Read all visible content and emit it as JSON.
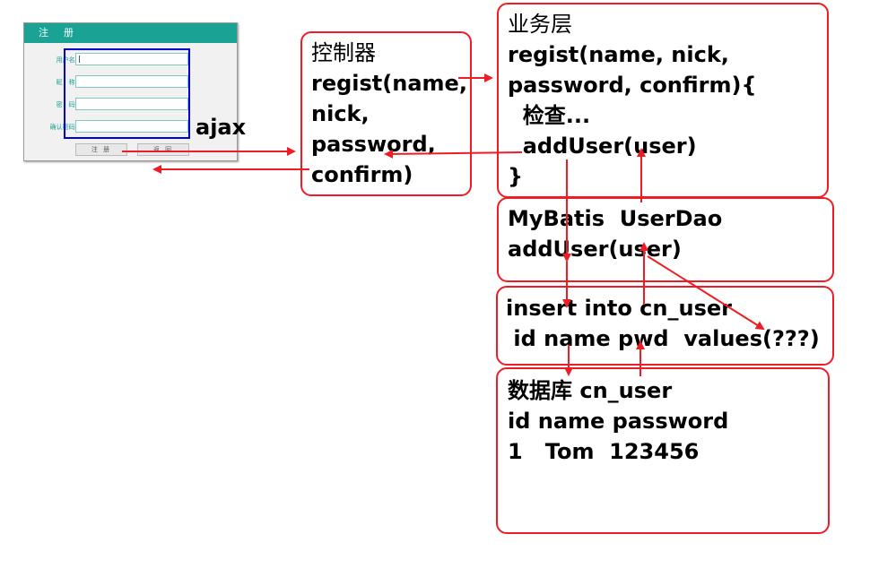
{
  "form": {
    "title": "注　册",
    "fields": [
      {
        "label": "用户名:",
        "value": "|"
      },
      {
        "label": "昵　称:",
        "value": ""
      },
      {
        "label": "密　码:",
        "value": ""
      },
      {
        "label": "确认密码:",
        "value": ""
      }
    ],
    "register_button": "注 册",
    "back_button": "返 回"
  },
  "ajax_label": "ajax",
  "controller": {
    "title": "控制器",
    "lines": [
      "regist(name,",
      "nick,",
      "password,",
      "confirm)"
    ]
  },
  "service": {
    "title": "业务层",
    "lines": [
      "regist(name, nick,",
      "password, confirm){",
      "  检查...",
      "  addUser(user)",
      "}"
    ]
  },
  "dao": {
    "lines": [
      "MyBatis  UserDao",
      "addUser(user)"
    ]
  },
  "sql": {
    "lines": [
      "insert into cn_user",
      " id name pwd  values(???)"
    ]
  },
  "database": {
    "lines": [
      "数据库 cn_user",
      "id name password",
      "1   Tom  123456"
    ]
  },
  "colors": {
    "arrow": "#ee1c24",
    "box_border": "#ee1c24",
    "form_header": "#1aa395",
    "selection": "#0000cc"
  }
}
